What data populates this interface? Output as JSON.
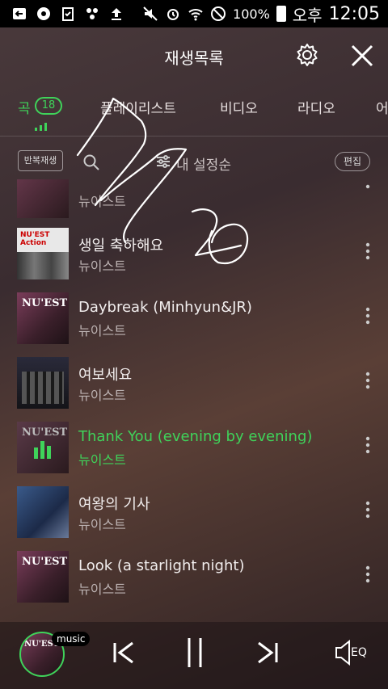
{
  "status_bar": {
    "battery_pct": "100%",
    "ampm": "오후",
    "time": "12:05"
  },
  "header": {
    "title": "재생목록"
  },
  "tabs": [
    {
      "label": "곡",
      "badge": "18"
    },
    {
      "label": "플레이리스트"
    },
    {
      "label": "비디오"
    },
    {
      "label": "라디오"
    },
    {
      "label": "어"
    }
  ],
  "toolbar": {
    "repeat_label": "반복재생",
    "sort_label": "내 설정순",
    "edit_label": "편집"
  },
  "songs": [
    {
      "title": "",
      "artist": "뉴이스트"
    },
    {
      "title": "생일 축하해요",
      "artist": "뉴이스트"
    },
    {
      "title": "Daybreak (Minhyun&JR)",
      "artist": "뉴이스트"
    },
    {
      "title": "여보세요",
      "artist": "뉴이스트"
    },
    {
      "title": "Thank You (evening by evening)",
      "artist": "뉴이스트",
      "playing": true
    },
    {
      "title": "여왕의 기사",
      "artist": "뉴이스트"
    },
    {
      "title": "Look (a starlight night)",
      "artist": "뉴이스트"
    }
  ],
  "album_art_text": [
    "NU'EST",
    "NU'EST Action"
  ],
  "player": {
    "tag": "music",
    "eq_label": "EQ"
  },
  "colors": {
    "accent": "#3fd35a"
  }
}
